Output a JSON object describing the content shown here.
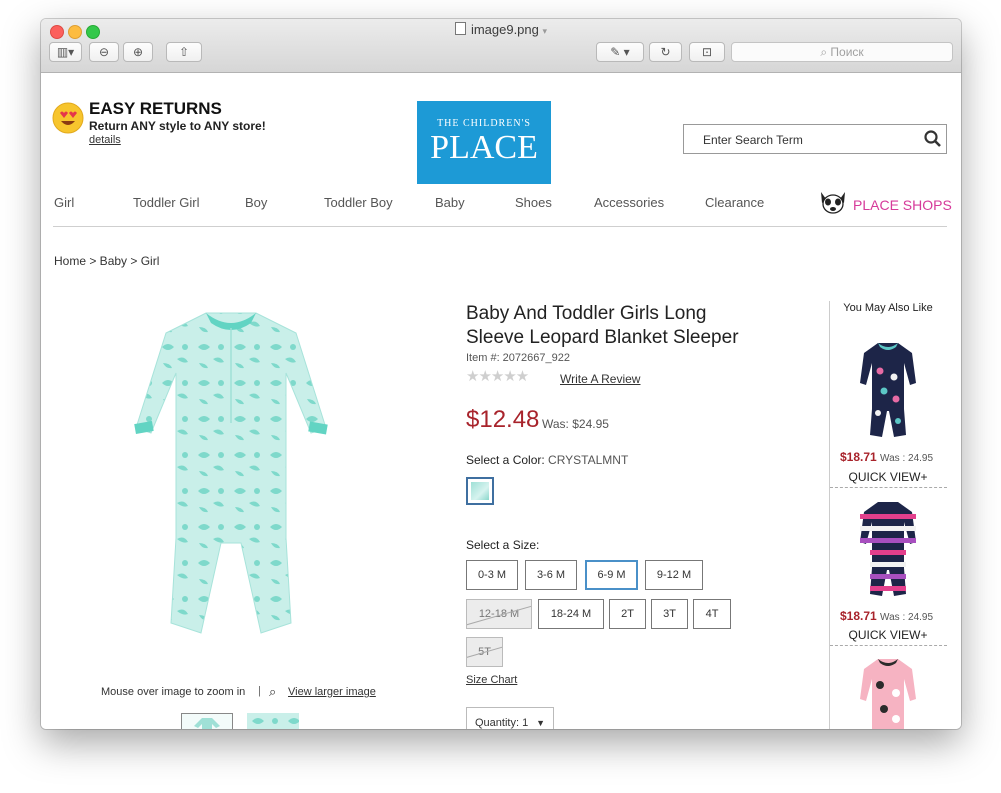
{
  "window": {
    "title": "image9.png",
    "search_placeholder": "Поиск"
  },
  "promo": {
    "title": "EASY RETURNS",
    "subtitle": "Return ANY style to ANY store!",
    "link": "details"
  },
  "logo": {
    "line1": "THE CHILDREN'S",
    "line2": "PLACE",
    "color": "#1d9ad6"
  },
  "search": {
    "placeholder": "Enter Search Term"
  },
  "nav": {
    "items": [
      "Girl",
      "Toddler Girl",
      "Boy",
      "Toddler Boy",
      "Baby",
      "Shoes",
      "Accessories",
      "Clearance"
    ],
    "place_shops": "PLACE SHOPS"
  },
  "breadcrumb": "Home > Baby > Girl",
  "product": {
    "title_line1": "Baby And Toddler Girls Long",
    "title_line2": "Sleeve Leopard Blanket Sleeper",
    "item_no": "Item #: 2072667_922",
    "review_link": "Write A Review",
    "price": "$12.48",
    "was": "Was: $24.95",
    "color_label": "Select a Color:",
    "color_value": "CRYSTALMNT",
    "size_label": "Select a Size:",
    "sizes": [
      {
        "label": "0-3 M",
        "state": "available"
      },
      {
        "label": "3-6 M",
        "state": "available"
      },
      {
        "label": "6-9 M",
        "state": "selected"
      },
      {
        "label": "9-12 M",
        "state": "available"
      },
      {
        "label": "12-18 M",
        "state": "unavailable"
      },
      {
        "label": "18-24 M",
        "state": "available"
      },
      {
        "label": "2T",
        "state": "available"
      },
      {
        "label": "3T",
        "state": "available"
      },
      {
        "label": "4T",
        "state": "available"
      },
      {
        "label": "5T",
        "state": "unavailable"
      }
    ],
    "size_chart": "Size Chart",
    "quantity": "Quantity: 1",
    "zoom_hint": "Mouse over image to zoom in",
    "larger_image": "View larger image"
  },
  "recommendations": {
    "title": "You May Also Like",
    "items": [
      {
        "price": "$18.71",
        "was": "Was : 24.95",
        "quick_view": "QUICK VIEW+"
      },
      {
        "price": "$18.71",
        "was": "Was : 24.95",
        "quick_view": "QUICK VIEW+"
      }
    ]
  },
  "colors": {
    "price_red": "#a8232b",
    "brand_blue": "#1d9ad6",
    "place_shops_pink": "#d63a9a",
    "mint": "#7ed9cb"
  }
}
